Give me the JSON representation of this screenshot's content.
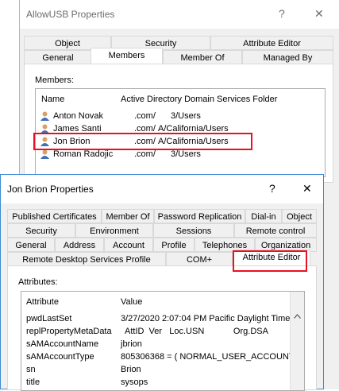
{
  "back_window": {
    "title": "AllowUSB Properties",
    "help_label": "?",
    "close_label": "✕",
    "tabs_row1": [
      "Object",
      "Security",
      "Attribute Editor"
    ],
    "tabs_row2": [
      "General",
      "Members",
      "Member Of",
      "Managed By"
    ],
    "selected_tab": "Members",
    "members_label": "Members:",
    "columns": [
      "Name",
      "Active Directory Domain Services Folder"
    ],
    "members": [
      {
        "name": "Anton Novak",
        "domain": ".com/",
        "folder": "3/Users"
      },
      {
        "name": "James Santi",
        "domain": ".com/",
        "folder": "A/California/Users"
      },
      {
        "name": "Jon Brion",
        "domain": ".com/",
        "folder": "A/California/Users"
      },
      {
        "name": "Roman Radojic",
        "domain": ".com/",
        "folder": "3/Users"
      }
    ]
  },
  "front_window": {
    "title": "Jon Brion Properties",
    "help_label": "?",
    "close_label": "✕",
    "tabs_row1": [
      "Published Certificates",
      "Member Of",
      "Password Replication",
      "Dial-in",
      "Object"
    ],
    "tabs_row2": [
      "Security",
      "Environment",
      "Sessions",
      "Remote control"
    ],
    "tabs_row3": [
      "General",
      "Address",
      "Account",
      "Profile",
      "Telephones",
      "Organization"
    ],
    "tabs_row4": [
      "Remote Desktop Services Profile",
      "COM+",
      "Attribute Editor"
    ],
    "selected_tab": "Attribute Editor",
    "attributes_label": "Attributes:",
    "columns": [
      "Attribute",
      "Value"
    ],
    "attributes": [
      {
        "attribute": "pwdLastSet",
        "value": "3/27/2020 2:07:04 PM Pacific Daylight Time"
      },
      {
        "attribute": "replPropertyMetaData",
        "value": "AttID  Ver   Loc.USN            Org.DSA"
      },
      {
        "attribute": "sAMAccountName",
        "value": "jbrion"
      },
      {
        "attribute": "sAMAccountType",
        "value": "805306368 = ( NORMAL_USER_ACCOUNT"
      },
      {
        "attribute": "sn",
        "value": "Brion"
      },
      {
        "attribute": "title",
        "value": "sysops"
      }
    ]
  },
  "colors": {
    "highlight": "#e81123",
    "front_border": "#3b8bd6"
  }
}
